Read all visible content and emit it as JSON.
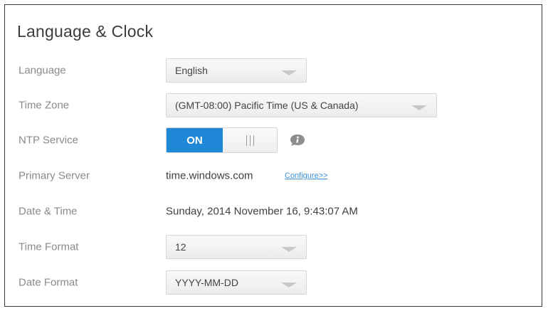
{
  "title": "Language & Clock",
  "rows": {
    "language": {
      "label": "Language",
      "value": "English"
    },
    "timezone": {
      "label": "Time Zone",
      "value": "(GMT-08:00) Pacific Time (US & Canada)"
    },
    "ntp": {
      "label": "NTP Service",
      "toggle_on": "ON",
      "state": "on",
      "info_icon": "info-icon"
    },
    "primary_server": {
      "label": "Primary Server",
      "value": "time.windows.com",
      "link": "Configure>>"
    },
    "datetime": {
      "label": "Date & Time",
      "value": "Sunday, 2014 November 16, 9:43:07 AM"
    },
    "time_format": {
      "label": "Time Format",
      "value": "12"
    },
    "date_format": {
      "label": "Date Format",
      "value": "YYYY-MM-DD"
    }
  },
  "colors": {
    "accent": "#1f88d6",
    "link": "#3a8fd4",
    "border": "#3a3a3a"
  }
}
